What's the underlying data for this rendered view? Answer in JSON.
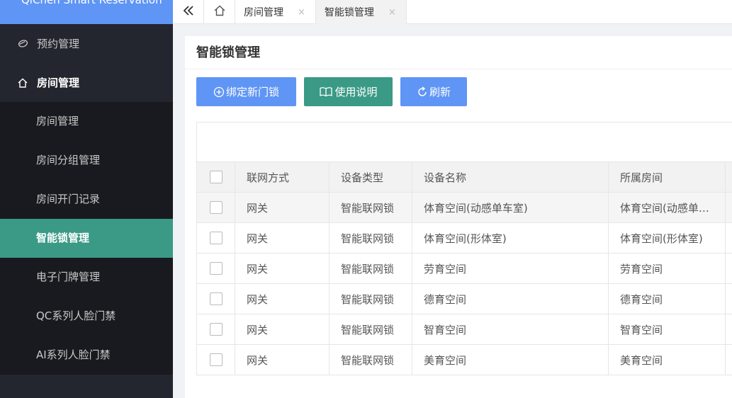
{
  "sidebar": {
    "logo": "QiChen Smart Reservation",
    "top_items": [
      {
        "label": "预约管理",
        "icon": "reservation-icon"
      },
      {
        "label": "房间管理",
        "icon": "home-icon"
      }
    ],
    "sub_items": [
      {
        "label": "房间管理"
      },
      {
        "label": "房间分组管理"
      },
      {
        "label": "房间开门记录"
      },
      {
        "label": "智能锁管理",
        "active": true
      },
      {
        "label": "电子门牌管理"
      },
      {
        "label": "QC系列人脸门禁"
      },
      {
        "label": "AI系列人脸门禁"
      }
    ]
  },
  "tabbar": {
    "tabs": [
      {
        "label": "房间管理",
        "close": "×"
      },
      {
        "label": "智能锁管理",
        "close": "×",
        "active": true
      }
    ]
  },
  "main": {
    "title": "智能锁管理",
    "buttons": {
      "bind": "绑定新门锁",
      "help": "使用说明",
      "refresh": "刷新"
    },
    "table": {
      "columns": [
        "联网方式",
        "设备类型",
        "设备名称",
        "所属房间"
      ],
      "rows": [
        [
          "网关",
          "智能联网锁",
          "体育空间(动感单车室)",
          "体育空间(动感单车室)"
        ],
        [
          "网关",
          "智能联网锁",
          "体育空间(形体室)",
          "体育空间(形体室)"
        ],
        [
          "网关",
          "智能联网锁",
          "劳育空间",
          "劳育空间"
        ],
        [
          "网关",
          "智能联网锁",
          "德育空间",
          "德育空间"
        ],
        [
          "网关",
          "智能联网锁",
          "智育空间",
          "智育空间"
        ],
        [
          "网关",
          "智能联网锁",
          "美育空间",
          "美育空间"
        ]
      ]
    }
  },
  "colors": {
    "primary": "#5f95f5",
    "accent": "#3a9a86",
    "sidebar_bg": "#23262e",
    "submenu_bg": "#181a1f"
  }
}
